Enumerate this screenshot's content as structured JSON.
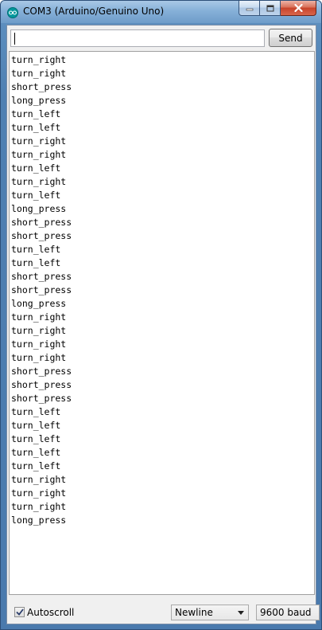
{
  "window": {
    "title": "COM3 (Arduino/Genuino Uno)"
  },
  "send_bar": {
    "input_value": "",
    "send_label": "Send"
  },
  "output": {
    "lines": [
      "turn_right",
      "turn_right",
      "short_press",
      "long_press",
      "turn_left",
      "turn_left",
      "turn_right",
      "turn_right",
      "turn_left",
      "turn_right",
      "turn_left",
      "long_press",
      "short_press",
      "short_press",
      "turn_left",
      "turn_left",
      "short_press",
      "short_press",
      "long_press",
      "turn_right",
      "turn_right",
      "turn_right",
      "turn_right",
      "short_press",
      "short_press",
      "short_press",
      "turn_left",
      "turn_left",
      "turn_left",
      "turn_left",
      "turn_left",
      "turn_right",
      "turn_right",
      "turn_right",
      "long_press"
    ]
  },
  "footer": {
    "autoscroll_label": "Autoscroll",
    "autoscroll_checked": true,
    "line_ending": "Newline",
    "baud_rate": "9600 baud"
  },
  "colors": {
    "arduino_teal": "#00979c",
    "titlebar_blue": "#86b0d8",
    "close_red": "#c7432a"
  }
}
